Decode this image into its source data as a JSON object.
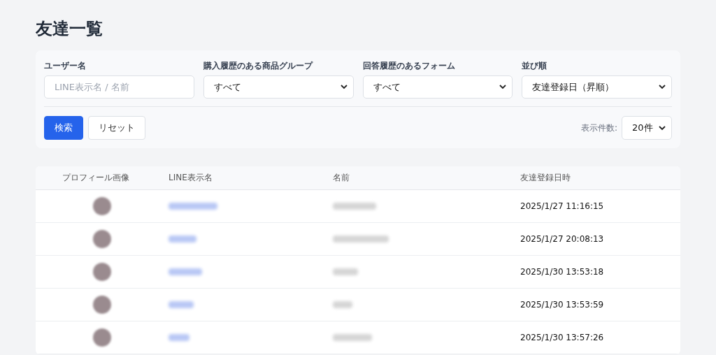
{
  "page_title": "友達一覧",
  "filters": [
    {
      "kind": "text",
      "label": "ユーザー名",
      "placeholder": "LINE表示名 / 名前"
    },
    {
      "kind": "select",
      "label": "購入履歴のある商品グループ",
      "value": "すべて"
    },
    {
      "kind": "select",
      "label": "回答履歴のあるフォーム",
      "value": "すべて"
    },
    {
      "kind": "select",
      "label": "並び順",
      "value": "友達登録日（昇順）"
    }
  ],
  "buttons": [
    {
      "kind": "primary",
      "label": "検索"
    },
    {
      "kind": "secondary",
      "label": "リセット"
    }
  ],
  "page_size": {
    "label": "表示件数:",
    "value": "20件"
  },
  "table": {
    "columns": [
      "プロフィール画像",
      "LINE表示名",
      "名前",
      "友達登録日時"
    ],
    "rows": [
      {
        "registered_at": "2025/1/27 11:16:15"
      },
      {
        "registered_at": "2025/1/27 20:08:13"
      },
      {
        "registered_at": "2025/1/30 13:53:18"
      },
      {
        "registered_at": "2025/1/30 13:53:59"
      },
      {
        "registered_at": "2025/1/30 13:57:26"
      }
    ]
  }
}
